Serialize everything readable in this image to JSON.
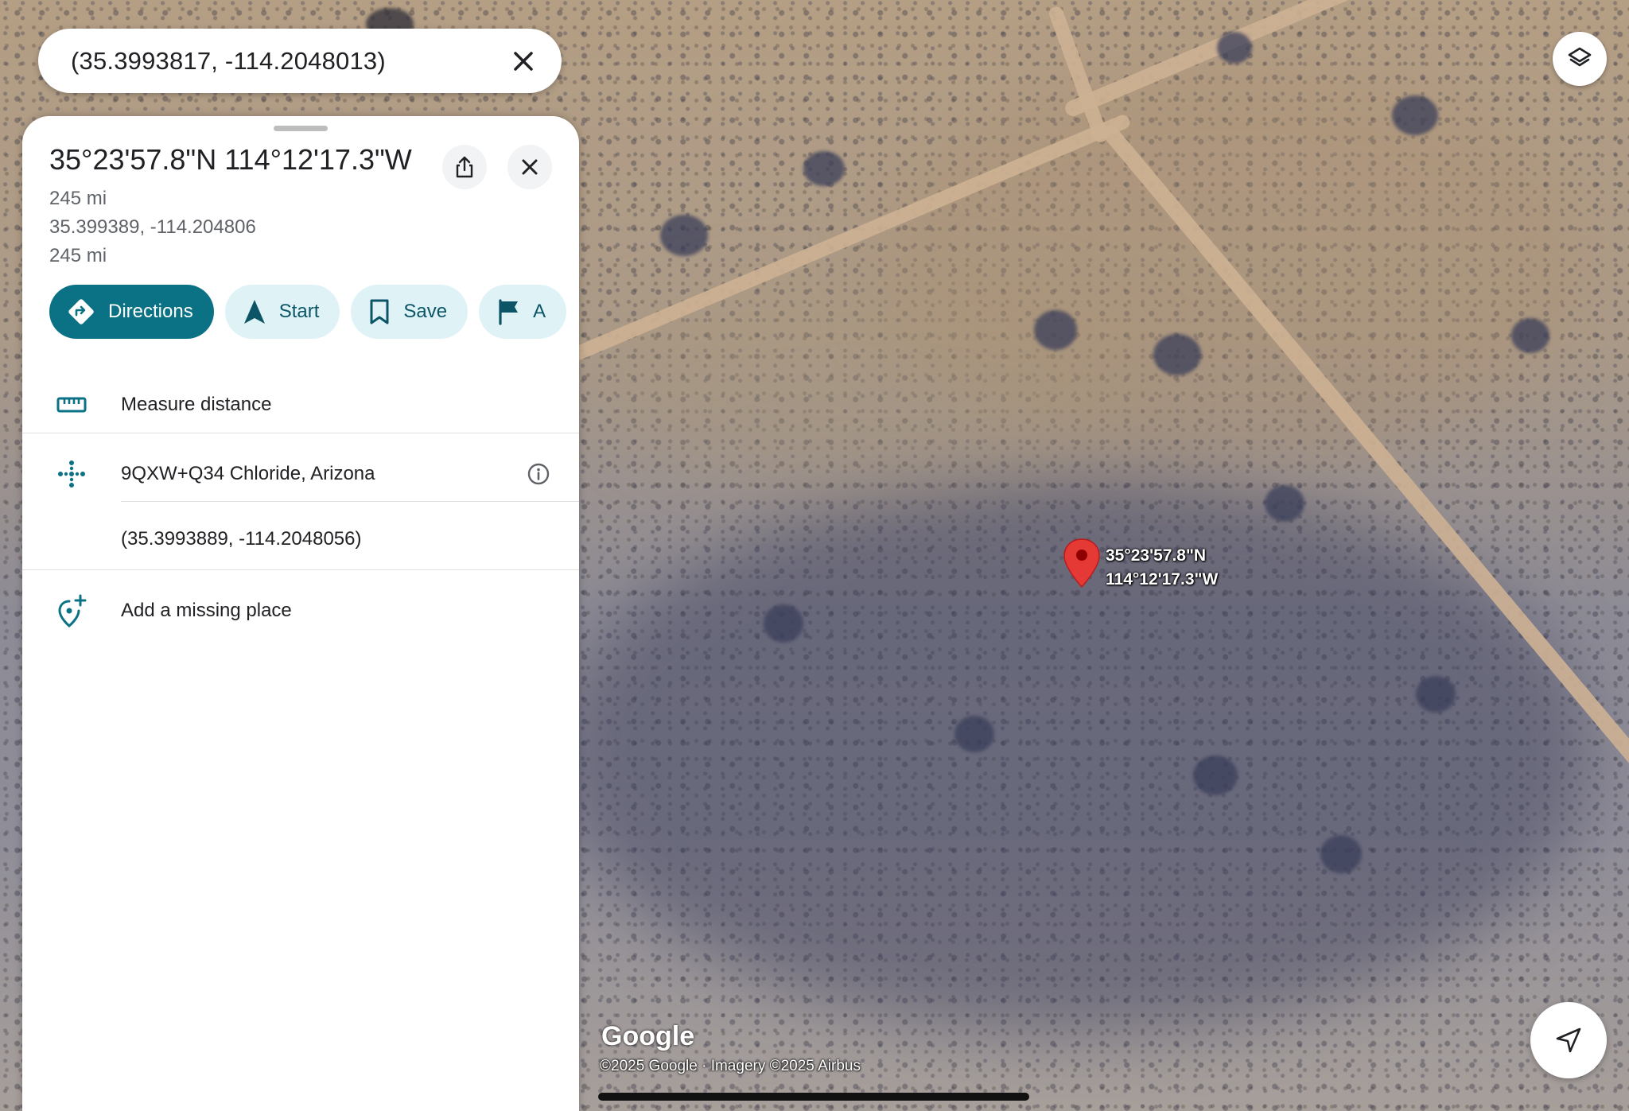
{
  "search": {
    "query": "(35.3993817, -114.2048013)"
  },
  "place": {
    "title": "35°23'57.8\"N 114°12'17.3\"W",
    "distance_1": "245 mi",
    "decimal_coords": "35.399389, -114.204806",
    "distance_2": "245 mi"
  },
  "actions": {
    "directions": "Directions",
    "start": "Start",
    "save": "Save",
    "label_partial": "A"
  },
  "list": {
    "measure_distance": "Measure distance",
    "plus_code": "9QXW+Q34 Chloride, Arizona",
    "precise_coords": "(35.3993889, -114.2048056)",
    "add_missing_place": "Add a missing place"
  },
  "map": {
    "pin_label_line1": "35°23'57.8\"N",
    "pin_label_line2": "114°12'17.3\"W",
    "logo": "Google",
    "copyright": "©2025 Google · Imagery ©2025 Airbus"
  },
  "colors": {
    "accent": "#0b7285",
    "chip_bg": "#dff3f7",
    "pin": "#e53935"
  },
  "icons": {
    "clear": "close-icon",
    "layers": "layers-icon",
    "share": "share-icon",
    "close": "close-icon",
    "directions": "directions-icon",
    "start": "navigation-arrow-icon",
    "save": "bookmark-icon",
    "label": "flag-icon",
    "measure": "ruler-icon",
    "plus_code": "plus-code-icon",
    "info": "info-icon",
    "add_place": "add-location-icon",
    "my_location": "location-arrow-icon",
    "pin": "map-pin-icon"
  }
}
